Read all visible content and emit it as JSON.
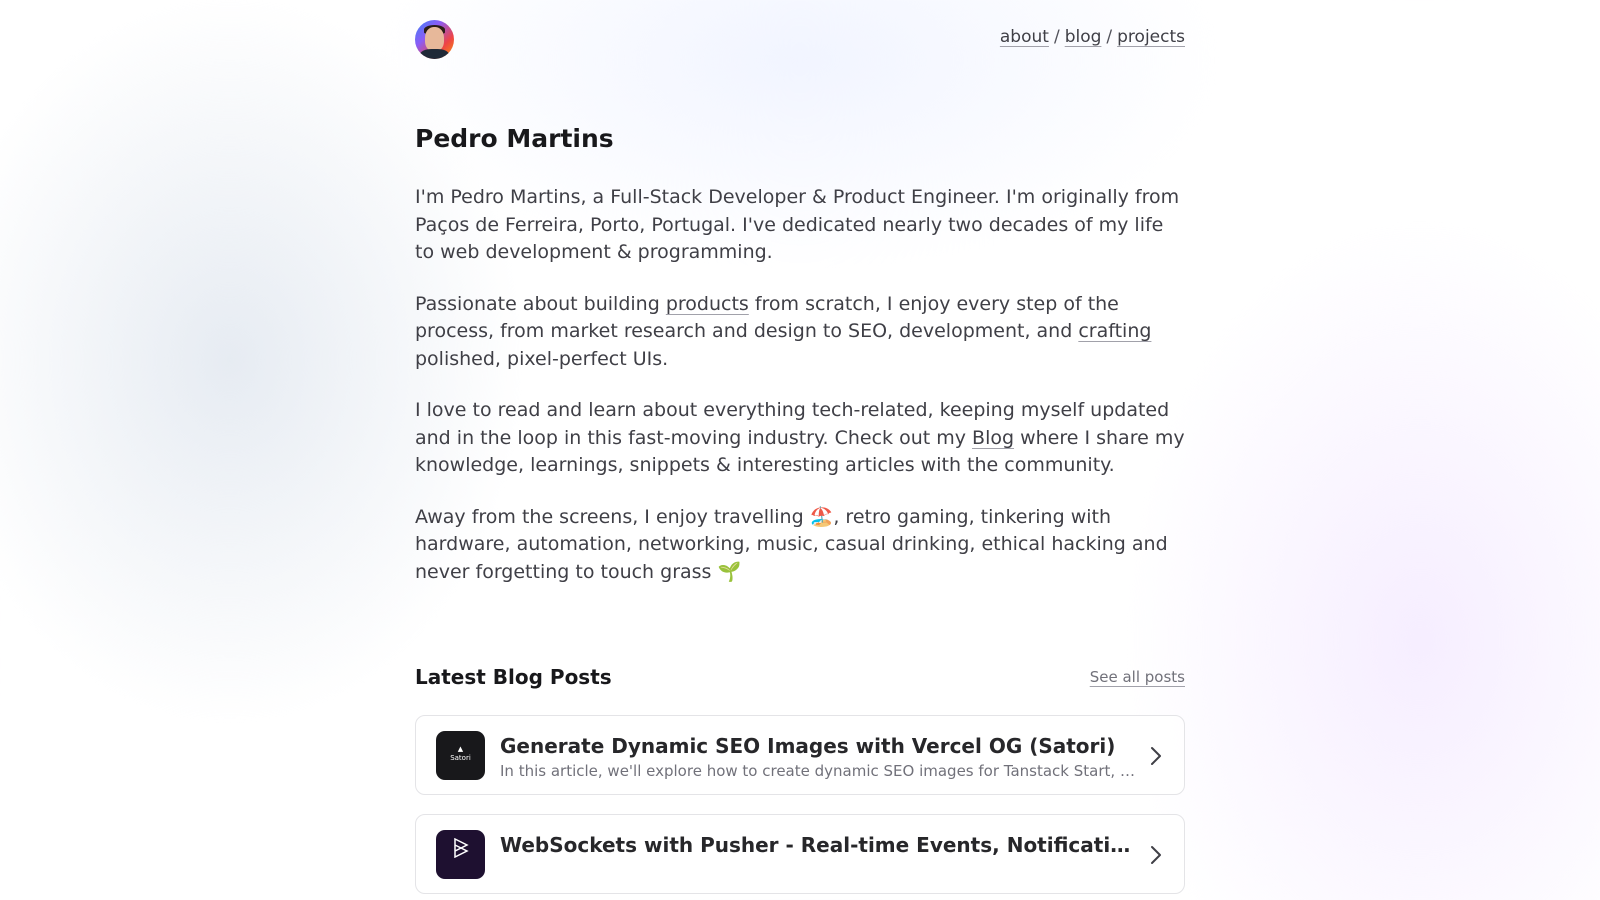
{
  "nav": {
    "about": "about",
    "blog": "blog",
    "projects": "projects",
    "separator": "/"
  },
  "profile": {
    "name": "Pedro Martins"
  },
  "bio": {
    "p1": "I'm Pedro Martins, a Full-Stack Developer & Product Engineer. I'm originally from Paços de Ferreira, Porto, Portugal. I've dedicated nearly two decades of my life to web development & programming.",
    "p2_before_products": "Passionate about building ",
    "p2_products_link": "products",
    "p2_middle": " from scratch, I enjoy every step of the process, from market research and design to SEO, development, and ",
    "p2_crafting_link": "crafting",
    "p2_after": " polished, pixel-perfect UIs.",
    "p3_before": "I love to read and learn about everything tech-related, keeping myself updated and in the loop in this fast-moving industry. Check out my ",
    "p3_blog_link": "Blog",
    "p3_after": " where I share my knowledge, learnings, snippets & interesting articles with the community.",
    "p4": "Away from the screens, I enjoy travelling 🏖️, retro gaming, tinkering with hardware, automation, networking, music, casual drinking, ethical hacking and never forgetting to touch grass 🌱"
  },
  "posts": {
    "heading": "Latest Blog Posts",
    "see_all": "See all posts",
    "items": [
      {
        "title": "Generate Dynamic SEO Images with Vercel OG (Satori)",
        "description": "In this article, we'll explore how to create dynamic SEO images for Tanstack Start, using Vercel OG",
        "thumb_text": "Satori"
      },
      {
        "title": "WebSockets with Pusher - Real-time Events, Notifications",
        "description": "",
        "thumb_text": ""
      }
    ]
  },
  "icons": {
    "chevron": "chevron-right-icon",
    "avatar": "avatar"
  }
}
